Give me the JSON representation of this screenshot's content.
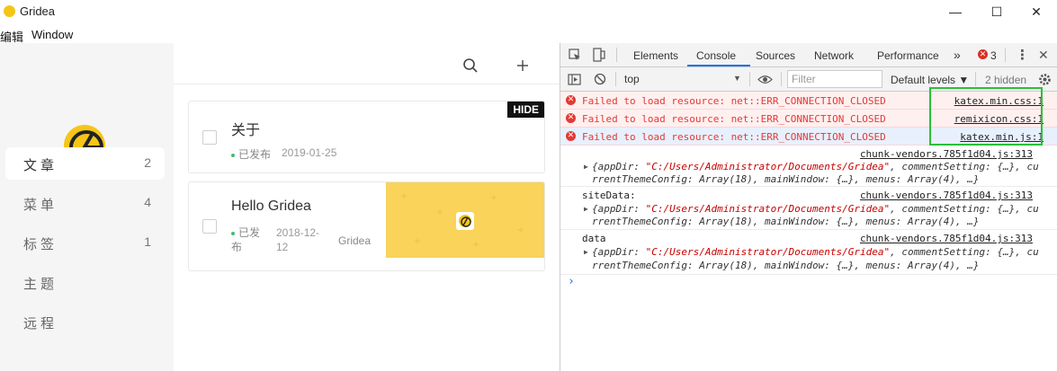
{
  "window": {
    "title": "Gridea",
    "menu": [
      "编辑",
      "Window"
    ],
    "controls": [
      "—",
      "☐",
      "✕"
    ]
  },
  "sidebar": {
    "items": [
      {
        "label": "文章",
        "count": "2",
        "active": true
      },
      {
        "label": "菜单",
        "count": "4",
        "active": false
      },
      {
        "label": "标签",
        "count": "1",
        "active": false
      },
      {
        "label": "主题",
        "count": "",
        "active": false
      },
      {
        "label": "远程",
        "count": "",
        "active": false
      }
    ]
  },
  "main": {
    "toolbar": {
      "search_icon": "search-icon",
      "add_icon": "plus-icon"
    },
    "posts": [
      {
        "title": "关于",
        "status": "已发布",
        "date": "2019-01-25",
        "badge": "HIDE",
        "tag": ""
      },
      {
        "title": "Hello Gridea",
        "status": "已发布",
        "date": "2018-12-12",
        "badge": "",
        "tag": "Gridea"
      }
    ]
  },
  "devtools": {
    "tabs": [
      "Elements",
      "Console",
      "Sources",
      "Network",
      "Performance",
      "»"
    ],
    "active_tab": "Console",
    "error_count": "3",
    "context": "top",
    "filter_placeholder": "Filter",
    "levels": "Default levels ▼",
    "hidden": "2 hidden",
    "errors": [
      {
        "message": "Failed to load resource: net::ERR_CONNECTION_CLOSED",
        "source": "katex.min.css:1"
      },
      {
        "message": "Failed to load resource: net::ERR_CONNECTION_CLOSED",
        "source": "remixicon.css:1"
      },
      {
        "message": "Failed to load resource: net::ERR_CONNECTION_CLOSED",
        "source": "katex.min.js:1"
      }
    ],
    "logs": [
      {
        "label": "",
        "source": "chunk-vendors.785f1d04.js:313",
        "line1_pre": "{appDir: ",
        "line1_str": "\"C:/Users/Administrator/Documents/Gridea\"",
        "line1_post": ", commentSetting: {…}, cu",
        "line2": "rrentThemeConfig: Array(18), mainWindow: {…}, menus: Array(4), …}"
      },
      {
        "label": "siteData:",
        "source": "chunk-vendors.785f1d04.js:313",
        "line1_pre": "{appDir: ",
        "line1_str": "\"C:/Users/Administrator/Documents/Gridea\"",
        "line1_post": ", commentSetting: {…}, cu",
        "line2": "rrentThemeConfig: Array(18), mainWindow: {…}, menus: Array(4), …}"
      },
      {
        "label": "data",
        "source": "chunk-vendors.785f1d04.js:313",
        "line1_pre": "{appDir: ",
        "line1_str": "\"C:/Users/Administrator/Documents/Gridea\"",
        "line1_post": ", commentSetting: {…}, cu",
        "line2": "rrentThemeConfig: Array(18), mainWindow: {…}, menus: Array(4), …}"
      }
    ],
    "prompt": "›"
  }
}
